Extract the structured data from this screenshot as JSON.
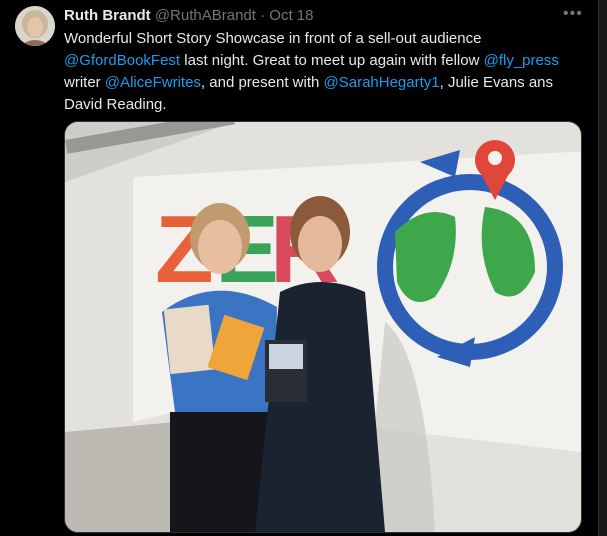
{
  "author": {
    "display_name": "Ruth Brandt",
    "handle": "@RuthABrandt",
    "separator": "·",
    "timestamp": "Oct 18"
  },
  "more_icon": "•••",
  "tweet": {
    "t1": "Wonderful Short Story Showcase in front of a sell-out audience",
    "m1": "@GfordBookFest",
    "t2": " last night. Great to meet up again with fellow ",
    "m2": "@fly_press",
    "t3": "writer ",
    "m3": "@AliceFwrites",
    "t4": ", and present with ",
    "m4": "@SarahHegarty1",
    "t5": ", Julie Evans ans",
    "t6": "David Reading."
  },
  "photo": {
    "banner_text": "ZERO"
  },
  "colors": {
    "link": "#1d9bf0",
    "text": "#e7e9ea",
    "muted": "#71767b",
    "background": "#000000"
  }
}
